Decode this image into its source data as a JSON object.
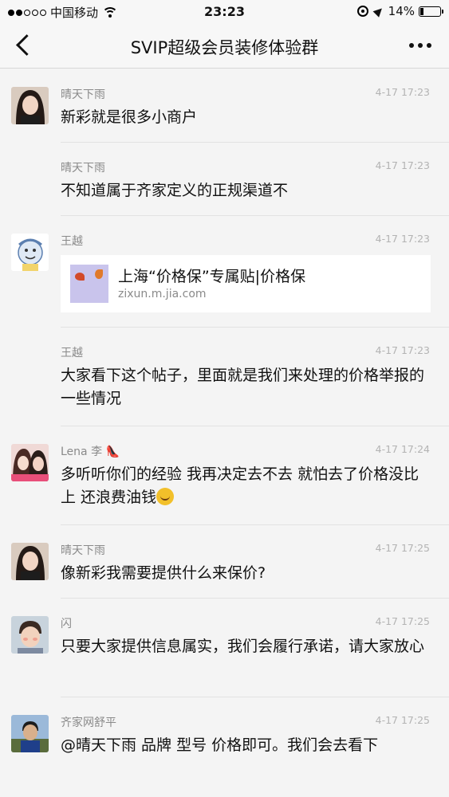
{
  "status_bar": {
    "carrier": "中国移动",
    "time": "23:23",
    "battery": "14%",
    "battery_level": 0.14
  },
  "nav": {
    "title": "SVIP超级会员装修体验群"
  },
  "messages": [
    {
      "sender": "晴天下雨",
      "time": "4-17 17:23",
      "text": "新彩就是很多小商户",
      "avatar": "avatar-woman-1"
    },
    {
      "sender": "晴天下雨",
      "time": "4-17 17:23",
      "text": "不知道属于齐家定义的正规渠道不"
    },
    {
      "sender": "王越",
      "time": "4-17 17:23",
      "avatar": "avatar-cartoon",
      "link": {
        "title": "上海“价格保”专属贴|价格保",
        "url": "zixun.m.jia.com"
      }
    },
    {
      "sender": "王越",
      "time": "4-17 17:23",
      "text": "大家看下这个帖子，里面就是我们来处理的价格举报的一些情况"
    },
    {
      "sender": "Lena 李 👠",
      "time": "4-17 17:24",
      "text": "多听听你们的经验 我再决定去不去 就怕去了价格没比上 还浪费油钱",
      "emoji": "laugh-cry-emoji",
      "avatar": "avatar-lena"
    },
    {
      "sender": "晴天下雨",
      "time": "4-17 17:25",
      "text": "像新彩我需要提供什么来保价?",
      "avatar": "avatar-woman-1"
    },
    {
      "sender": "闪",
      "time": "4-17 17:25",
      "text": "只要大家提供信息属实，我们会履行承诺，请大家放心",
      "avatar": "avatar-child"
    },
    {
      "sender": "齐家网舒平",
      "time": "4-17 17:25",
      "text": "@晴天下雨 品牌 型号 价格即可。我们会去看下",
      "avatar": "avatar-man"
    }
  ]
}
